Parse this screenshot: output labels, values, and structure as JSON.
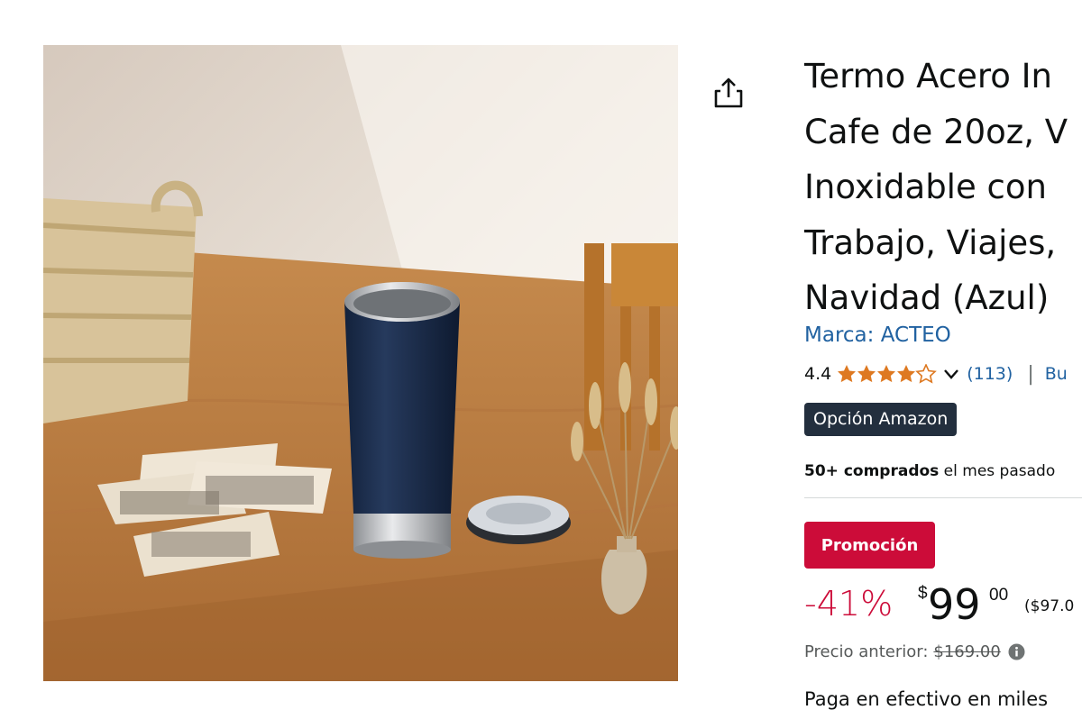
{
  "product": {
    "title_lines": [
      "Termo Acero In",
      "Cafe de 20oz, V",
      "Inoxidable con",
      "Trabajo, Viajes,",
      "Navidad (Azul)"
    ],
    "brand": "Marca: ACTEO",
    "rating": "4.4",
    "rating_stars": 4.4,
    "reviews": "(113)",
    "pipe": "|",
    "search_link": "Bu",
    "choice_badge": "Opción Amazon",
    "bought_bold": "50+ comprados",
    "bought_rest": " el mes pasado",
    "promo_badge": "Promoción",
    "discount": "-41%",
    "currency": "$",
    "price_whole": "99",
    "price_fraction": "00",
    "unit_price": "($97.0",
    "previous_price_label": "Precio anterior:",
    "previous_price": "$169.00",
    "cut_line": "Paga en efectivo en miles"
  },
  "icons": {
    "share": "share-icon",
    "chevron": "chevron-down-icon",
    "info": "info-icon"
  },
  "colors": {
    "link": "#2162a1",
    "promo": "#cc0c39",
    "star": "#de7921",
    "choice_bg": "#232f3e"
  }
}
